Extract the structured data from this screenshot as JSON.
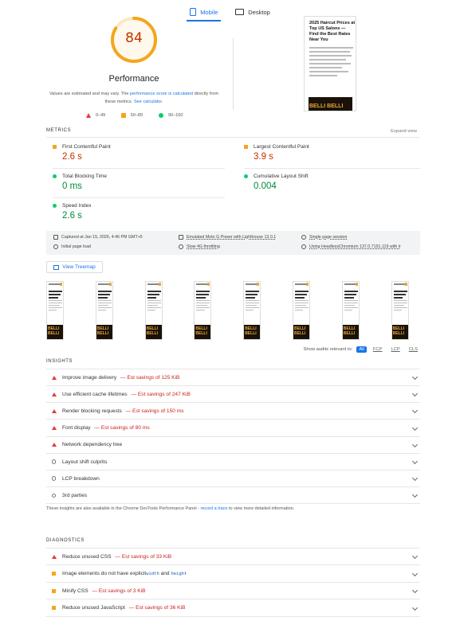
{
  "tabs": [
    {
      "label": "Mobile",
      "active": true
    },
    {
      "label": "Desktop",
      "active": false
    }
  ],
  "score": {
    "value": "84",
    "fraction": 0.84,
    "title": "Performance",
    "color": "#f4a61c"
  },
  "note": {
    "text1": "Values are estimated and may vary. The ",
    "link1": "performance score is calculated",
    "text2": " directly from these metrics. ",
    "link2": "See calculator."
  },
  "legend": [
    {
      "label": "0–49",
      "shape": "triangle",
      "color": "#e53935"
    },
    {
      "label": "50–89",
      "shape": "square",
      "color": "#f4a61c"
    },
    {
      "label": "90–100",
      "shape": "circle",
      "color": "#0cce6b"
    }
  ],
  "thumbnail": {
    "title": "2025 Haircut Prices at Top US Salons — Find the Best Rates Near You",
    "image_text": "BELLI BELLI"
  },
  "metrics": {
    "section_label": "METRICS",
    "expand_label": "Expand view",
    "fcp": {
      "label": "First Contentful Paint",
      "value": "2.6 s"
    },
    "lcp": {
      "label": "Largest Contentful Paint",
      "value": "3.9 s"
    },
    "tbt": {
      "label": "Total Blocking Time",
      "value": "0 ms"
    },
    "cls": {
      "label": "Cumulative Layout Shift",
      "value": "0.004"
    },
    "si": {
      "label": "Speed Index",
      "value": "2.6 s"
    }
  },
  "env": {
    "captured": "Captured at Jan 15, 2026, 4:46 PM GMT+5",
    "device": "Emulated Moto G Power with Lighthouse 13.0.1",
    "session": "Single page session",
    "load": "Initial page load",
    "throttle": "Slow 4G throttling",
    "browser": "Using HeadlessChromium 137.0.7151.119 with lr"
  },
  "treemap_label": "View Treemap",
  "filmstrip": {
    "count": 8,
    "frame_title": "2025 Haircut Prices at Top US Salons — Find the Best Rates Near You",
    "frame_image_text": "BELLI BELLI"
  },
  "audit_filter": {
    "label": "Show audits relevant to:",
    "chips": [
      "All",
      "FCP",
      "LCP",
      "CLS"
    ]
  },
  "insights": {
    "section_label": "INSIGHTS",
    "items": [
      {
        "icon": "fail",
        "title": "Improve image delivery",
        "savings": "Est savings of 125 KiB"
      },
      {
        "icon": "fail",
        "title": "Use efficient cache lifetimes",
        "savings": "Est savings of 247 KiB"
      },
      {
        "icon": "fail",
        "title": "Render blocking requests",
        "savings": "Est savings of 150 ms"
      },
      {
        "icon": "fail",
        "title": "Font display",
        "savings": "Est savings of 80 ms"
      },
      {
        "icon": "fail",
        "title": "Network dependency tree",
        "savings": ""
      },
      {
        "icon": "info",
        "title": "Layout shift culprits",
        "savings": ""
      },
      {
        "icon": "info",
        "title": "LCP breakdown",
        "savings": ""
      },
      {
        "icon": "info",
        "title": "3rd parties",
        "savings": ""
      }
    ],
    "note_text1": "These insights are also available in the Chrome DevTools Performance Panel - ",
    "note_link": "record a trace",
    "note_text2": " to view more detailed information."
  },
  "diagnostics": {
    "section_label": "DIAGNOSTICS",
    "items": [
      {
        "icon": "fail",
        "title": "Reduce unused CSS",
        "savings": "Est savings of 33 KiB"
      },
      {
        "icon": "average",
        "title": "Image elements do not have explicit ",
        "code1": "width",
        "mid": " and ",
        "code2": "height"
      },
      {
        "icon": "average",
        "title": "Minify CSS",
        "savings": "Est savings of 3 KiB"
      },
      {
        "icon": "average",
        "title": "Reduce unused JavaScript",
        "savings": "Est savings of 36 KiB"
      }
    ]
  }
}
